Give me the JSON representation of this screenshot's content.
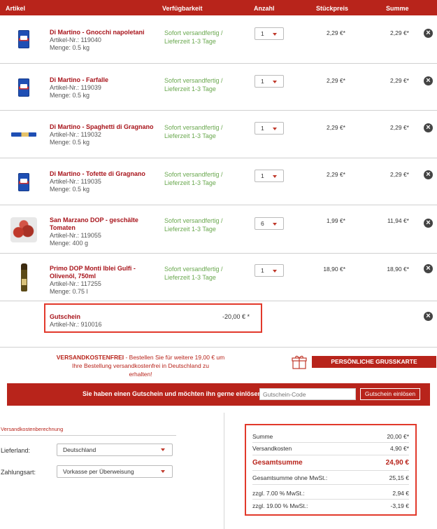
{
  "table_header": {
    "article": "Artikel",
    "availability": "Verfügbarkeit",
    "quantity": "Anzahl",
    "unit_price": "Stückpreis",
    "sum": "Summe"
  },
  "items": [
    {
      "name": "Di Martino - Gnocchi napoletani",
      "article_no": "Artikel-Nr.: 119040",
      "amount": "Menge: 0.5 kg",
      "availability_1": "Sofort versandfertig /",
      "availability_2": "Lieferzeit 1-3 Tage",
      "qty": "1",
      "unit_price": "2,29 €*",
      "sum": "2,29 €*",
      "image_icon": "pasta-pack-icon"
    },
    {
      "name": "Di Martino - Farfalle",
      "article_no": "Artikel-Nr.: 119039",
      "amount": "Menge: 0.5 kg",
      "availability_1": "Sofort versandfertig /",
      "availability_2": "Lieferzeit 1-3 Tage",
      "qty": "1",
      "unit_price": "2,29 €*",
      "sum": "2,29 €*",
      "image_icon": "pasta-pack-icon"
    },
    {
      "name": "Di Martino - Spaghetti di Gragnano",
      "article_no": "Artikel-Nr.: 119032",
      "amount": "Menge: 0.5 kg",
      "availability_1": "Sofort versandfertig /",
      "availability_2": "Lieferzeit 1-3 Tage",
      "qty": "1",
      "unit_price": "2,29 €*",
      "sum": "2,29 €*",
      "image_icon": "spaghetti-pack-icon"
    },
    {
      "name": "Di Martino - Tofette di Gragnano",
      "article_no": "Artikel-Nr.: 119035",
      "amount": "Menge: 0.5 kg",
      "availability_1": "Sofort versandfertig /",
      "availability_2": "Lieferzeit 1-3 Tage",
      "qty": "1",
      "unit_price": "2,29 €*",
      "sum": "2,29 €*",
      "image_icon": "pasta-pack-icon"
    },
    {
      "name_1": "San Marzano DOP - geschälte",
      "name_2": "Tomaten",
      "article_no": "Artikel-Nr.: 119055",
      "amount": "Menge: 400 g",
      "availability_1": "Sofort versandfertig /",
      "availability_2": "Lieferzeit 1-3 Tage",
      "qty": "6",
      "unit_price": "1,99 €*",
      "sum": "11,94 €*",
      "image_icon": "tomato-tin-icon"
    },
    {
      "name_1": "Primo DOP Monti Iblei Gulfi -",
      "name_2": "Olivenöl, 750ml",
      "article_no": "Artikel-Nr.: 117255",
      "amount": "Menge: 0.75 l",
      "availability_1": "Sofort versandfertig /",
      "availability_2": "Lieferzeit 1-3 Tage",
      "qty": "1",
      "unit_price": "18,90 €*",
      "sum": "18,90 €*",
      "image_icon": "olive-oil-bottle-icon"
    }
  ],
  "voucher": {
    "name": "Gutschein",
    "article_no": "Artikel-Nr.: 910016",
    "amount": "-20,00 € *"
  },
  "shipping_notice": {
    "highlight": "VERSANDKOSTENFREI",
    "text_1": " - Bestellen Sie für weitere 19,00 € um",
    "text_2": "Ihre Bestellung versandkostenfrei in Deutschland zu",
    "text_3": "erhalten!"
  },
  "gift_card_button": "PERSÖNLICHE GRUSSKARTE HINZUFÜGEN",
  "voucher_banner": {
    "question": "Sie haben einen Gutschein und möchten ihn gerne einlösen?",
    "input_placeholder": "Gutschein-Code",
    "button": "Gutschein einlösen"
  },
  "shipping_calc": {
    "title": "Versandkostenberechnung",
    "country_label": "Lieferland:",
    "country_value": "Deutschland",
    "payment_label": "Zahlungsart:",
    "payment_value": "Vorkasse per Überweisung"
  },
  "totals": {
    "sum_label": "Summe",
    "sum_value": "20,00 €*",
    "shipping_label": "Versandkosten",
    "shipping_value": "4,90 €*",
    "grand_label": "Gesamtsumme",
    "grand_value": "24,90 €",
    "net_label": "Gesamtsumme ohne MwSt.:",
    "net_value": "25,15 €",
    "vat7_label": "zzgl. 7.00 % MwSt.:",
    "vat7_value": "2,94 €",
    "vat19_label": "zzgl. 19.00 % MwSt.:",
    "vat19_value": "-3,19 €"
  },
  "colors": {
    "brand_red": "#b8241b",
    "availability_green": "#6aa84f",
    "highlight_border": "#e2392b"
  }
}
